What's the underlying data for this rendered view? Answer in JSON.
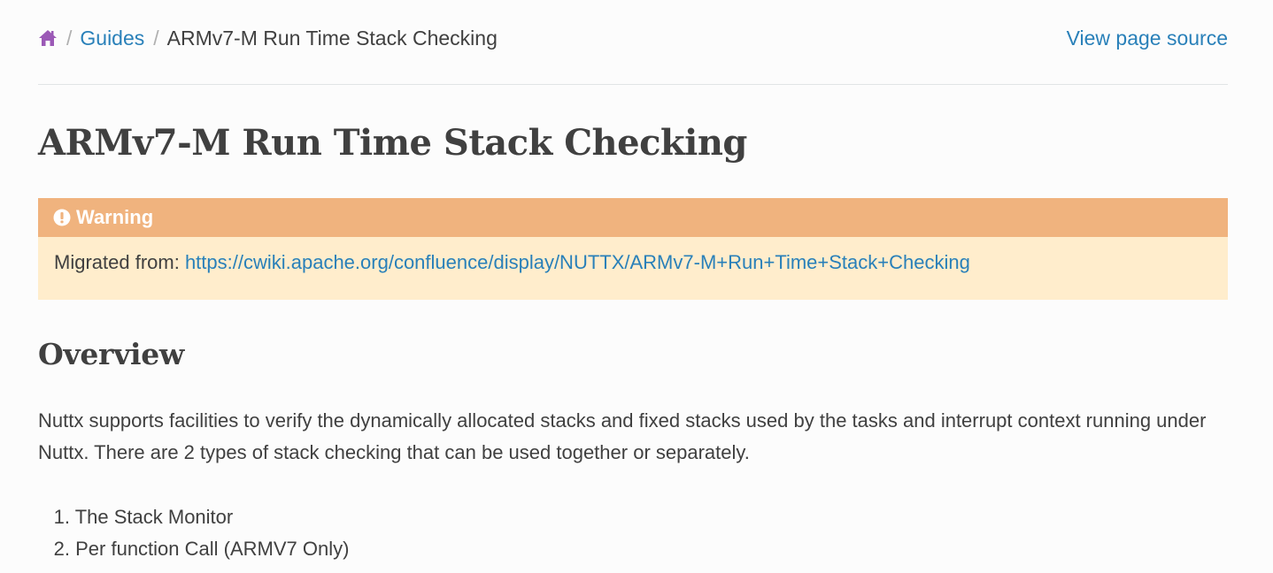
{
  "breadcrumbs": {
    "home_icon": "home-icon",
    "separator": "/",
    "items": [
      "Guides",
      "ARMv7-M Run Time Stack Checking"
    ],
    "view_source": "View page source"
  },
  "page_title": "ARMv7-M Run Time Stack Checking",
  "warning": {
    "icon": "exclamation-circle-icon",
    "title": "Warning",
    "prefix": "Migrated from: ",
    "link": "https://cwiki.apache.org/confluence/display/NUTTX/ARMv7-M+Run+Time+Stack+Checking"
  },
  "overview": {
    "heading": "Overview",
    "paragraph": "Nuttx supports facilities to verify the dynamically allocated stacks and fixed stacks used by the tasks and interrupt context running under Nuttx. There are 2 types of stack checking that can be used together or separately.",
    "list": [
      {
        "num": "1.",
        "text": "The Stack Monitor"
      },
      {
        "num": "2.",
        "text": "Per function Call (ARMV7 Only)"
      }
    ]
  },
  "colors": {
    "link": "#2980b9",
    "home_icon": "#9b59b6",
    "warning_title_bg": "#f0b37e",
    "warning_body_bg": "#ffedcc",
    "text": "#404040"
  }
}
